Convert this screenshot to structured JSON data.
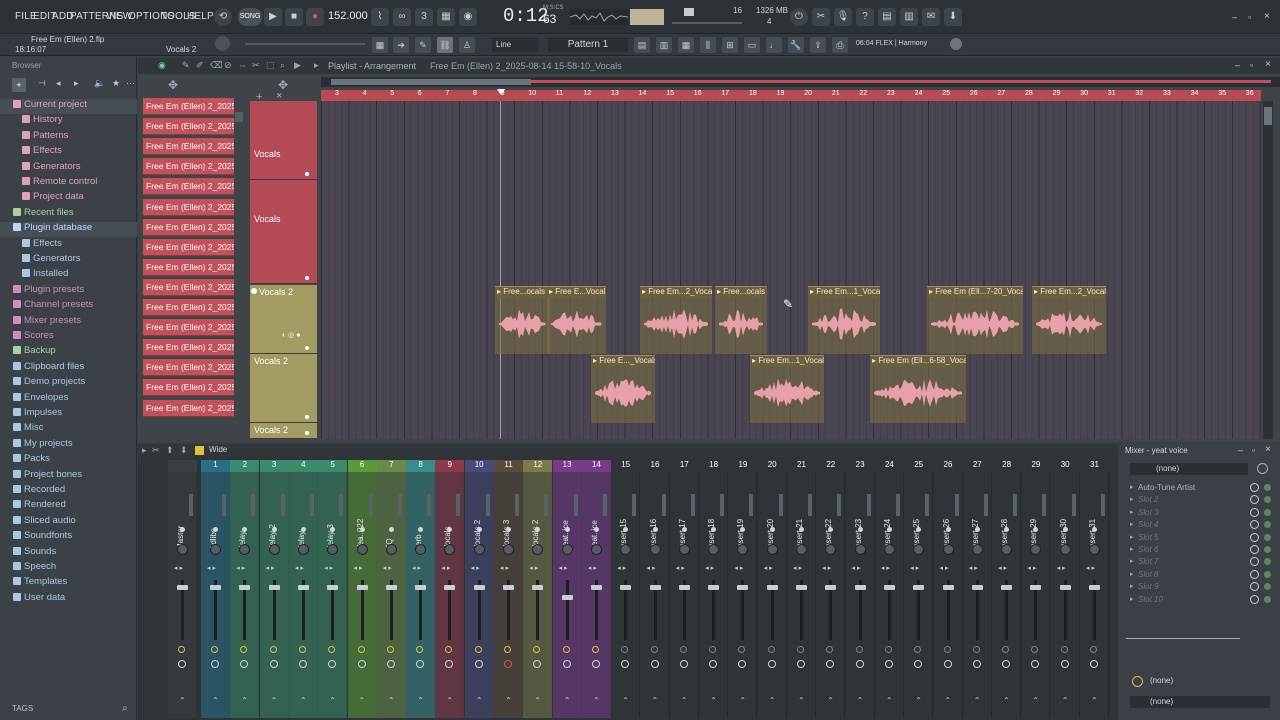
{
  "menu": [
    "FILE",
    "EDIT",
    "ADD",
    "PATTERNS",
    "VIEW",
    "OPTIONS",
    "TOOLS",
    "HELP"
  ],
  "transport": {
    "mode": "SONG",
    "tempo": "152.000",
    "time": "0:12",
    "time_sub": "63",
    "time_label": "M:S:CS",
    "pattern": "Pattern 1",
    "memory": "1326 MB",
    "cpu": "16",
    "voices": "4"
  },
  "project": {
    "file": "Free Em (Ellen) 2.flp",
    "time": "18:16:07",
    "channel": "Vocals 2",
    "snap": "Line",
    "hint": "06:04 FLEX | Harmony"
  },
  "browser": {
    "title": "Browser",
    "items": [
      {
        "label": "Current project",
        "color": "#e0a0b8",
        "indent": 0,
        "hl": true
      },
      {
        "label": "History",
        "color": "#e0a0b8",
        "indent": 1
      },
      {
        "label": "Patterns",
        "color": "#e0a0b8",
        "indent": 1
      },
      {
        "label": "Effects",
        "color": "#e0a0b8",
        "indent": 1
      },
      {
        "label": "Generators",
        "color": "#e0a0b8",
        "indent": 1
      },
      {
        "label": "Remote control",
        "color": "#e0a0b8",
        "indent": 1
      },
      {
        "label": "Project data",
        "color": "#e0a0b8",
        "indent": 1
      },
      {
        "label": "Recent files",
        "color": "#a8d2a0",
        "indent": 0
      },
      {
        "label": "Plugin database",
        "color": "#b8d8ff",
        "indent": 0,
        "hl": true
      },
      {
        "label": "Effects",
        "color": "#a8c8e8",
        "indent": 1
      },
      {
        "label": "Generators",
        "color": "#a8c8e8",
        "indent": 1
      },
      {
        "label": "Installed",
        "color": "#a8c8e8",
        "indent": 1
      },
      {
        "label": "Plugin presets",
        "color": "#d08cc0",
        "indent": 0
      },
      {
        "label": "Channel presets",
        "color": "#d08cc0",
        "indent": 0
      },
      {
        "label": "Mixer presets",
        "color": "#d08cc0",
        "indent": 0
      },
      {
        "label": "Scores",
        "color": "#d08cc0",
        "indent": 0
      },
      {
        "label": "Backup",
        "color": "#a8d2a0",
        "indent": 0
      },
      {
        "label": "Clipboard files",
        "color": "#a8c8e8",
        "indent": 0
      },
      {
        "label": "Demo projects",
        "color": "#a8c8e8",
        "indent": 0
      },
      {
        "label": "Envelopes",
        "color": "#a8c8e8",
        "indent": 0
      },
      {
        "label": "Impulses",
        "color": "#a8c8e8",
        "indent": 0
      },
      {
        "label": "Misc",
        "color": "#a8c8e8",
        "indent": 0
      },
      {
        "label": "My projects",
        "color": "#a8c8e8",
        "indent": 0
      },
      {
        "label": "Packs",
        "color": "#a8c8e8",
        "indent": 0
      },
      {
        "label": "Project bones",
        "color": "#a8c8e8",
        "indent": 0
      },
      {
        "label": "Recorded",
        "color": "#a8c8e8",
        "indent": 0
      },
      {
        "label": "Rendered",
        "color": "#a8c8e8",
        "indent": 0
      },
      {
        "label": "Sliced audio",
        "color": "#a8c8e8",
        "indent": 0
      },
      {
        "label": "Soundfonts",
        "color": "#a8c8e8",
        "indent": 0
      },
      {
        "label": "Sounds",
        "color": "#a8c8e8",
        "indent": 0
      },
      {
        "label": "Speech",
        "color": "#a8c8e8",
        "indent": 0
      },
      {
        "label": "Templates",
        "color": "#a8c8e8",
        "indent": 0
      },
      {
        "label": "User data",
        "color": "#a8c8e8",
        "indent": 0
      }
    ],
    "tags": "TAGS"
  },
  "playlist": {
    "title": "Playlist - Arrangement",
    "path": "Free Em (Ellen) 2_2025-08-14 15-58-10_Vocals",
    "patterns": [
      "Free Em (Ellen) 2_2025-0...",
      "Free Em (Ellen) 2_2025-0...",
      "Free Em (Ellen) 2_2025-0...",
      "Free Em (Ellen) 2_2025-0...",
      "Free Em (Ellen) 2_2025-0...",
      "Free Em (Ellen) 2_2025-0...",
      "Free Em (Ellen) 2_2025-0...",
      "Free Em (Ellen) 2_2025-0...",
      "Free Em (Ellen) 2_2025-0...",
      "Free Em (Ellen) 2_2025-0...",
      "Free Em (Ellen) 2_2025-0...",
      "Free Em (Ellen) 2_2025-0...",
      "Free Em (Ellen) 2_2025-0...",
      "Free Em (Ellen) 2_2025-0...",
      "Free Em (Ellen) 2_2025-0...",
      "Free Em (Ellen) 2_2025-0..."
    ],
    "tracks": [
      "Vocals",
      "Vocals",
      "Vocals 2",
      "Vocals 2",
      "Vocals 2"
    ],
    "ruler": [
      "3",
      "4",
      "5",
      "6",
      "7",
      "8",
      "9",
      "10",
      "11",
      "12",
      "13",
      "14",
      "15",
      "16",
      "17",
      "18",
      "19",
      "20",
      "21",
      "22",
      "23",
      "24",
      "25",
      "26",
      "27",
      "28",
      "29",
      "30",
      "31",
      "32",
      "33",
      "34",
      "35",
      "36"
    ],
    "clips_row1": [
      "Free...ocals",
      "Free E...Vocals",
      "Free Em...2_Vocals",
      "Free...ocals",
      "Free Em...1_Vocals",
      "Free Em (Ell...7-20_Vocals",
      "Free Em...2_Vocals"
    ],
    "clips_row2": [
      "Free E..._Vocals",
      "Free Em...1_Vocals",
      "Free Em (Ell...6-58_Vocals"
    ]
  },
  "mixer": {
    "title": "Mixer - yeat voice",
    "view": "Wide",
    "strips": [
      {
        "num": "",
        "name": "Master",
        "color": "#3a3f44"
      },
      {
        "num": "1",
        "name": "Adlibs",
        "color": "#2a6f8a"
      },
      {
        "num": "2",
        "name": "delay",
        "color": "#3a8b6c"
      },
      {
        "num": "3",
        "name": "delay 2",
        "color": "#3a8b6c"
      },
      {
        "num": "4",
        "name": "delay",
        "color": "#3a8b6c"
      },
      {
        "num": "5",
        "name": "delay 3",
        "color": "#3a8b6c"
      },
      {
        "num": "6",
        "name": "Yea..022",
        "color": "#5b9a3a"
      },
      {
        "num": "7",
        "name": "EQ",
        "color": "#6a8a4a"
      },
      {
        "num": "8",
        "name": "verb",
        "color": "#3a8b8b"
      },
      {
        "num": "9",
        "name": "Vocals",
        "color": "#8b3a4a"
      },
      {
        "num": "10",
        "name": "Vocals 2",
        "color": "#4a4a7a"
      },
      {
        "num": "11",
        "name": "Vocals 3",
        "color": "#5a4a3a"
      },
      {
        "num": "12",
        "name": "Vocals 2",
        "color": "#7a7a4a"
      },
      {
        "num": "13",
        "name": "yeat..ice",
        "color": "#7a3a8a"
      },
      {
        "num": "14",
        "name": "yeat..ice",
        "color": "#7a3a8a"
      },
      {
        "num": "15",
        "name": "Insert 15",
        "color": ""
      },
      {
        "num": "16",
        "name": "Insert 16",
        "color": ""
      },
      {
        "num": "17",
        "name": "Insert 17",
        "color": ""
      },
      {
        "num": "18",
        "name": "Insert 18",
        "color": ""
      },
      {
        "num": "19",
        "name": "Insert 19",
        "color": ""
      },
      {
        "num": "20",
        "name": "Insert 20",
        "color": ""
      },
      {
        "num": "21",
        "name": "Insert 21",
        "color": ""
      },
      {
        "num": "22",
        "name": "Insert 22",
        "color": ""
      },
      {
        "num": "23",
        "name": "Insert 23",
        "color": ""
      },
      {
        "num": "24",
        "name": "Insert 24",
        "color": ""
      },
      {
        "num": "25",
        "name": "Insert 25",
        "color": ""
      },
      {
        "num": "26",
        "name": "Insert 26",
        "color": ""
      },
      {
        "num": "27",
        "name": "Insert 27",
        "color": ""
      },
      {
        "num": "28",
        "name": "Insert 28",
        "color": ""
      },
      {
        "num": "29",
        "name": "Insert 29",
        "color": ""
      },
      {
        "num": "30",
        "name": "Insert 30",
        "color": ""
      },
      {
        "num": "31",
        "name": "Insert 31",
        "color": ""
      }
    ],
    "input": "(none)",
    "slots": [
      "Auto-Tune Artist",
      "Slot 2",
      "Slot 3",
      "Slot 4",
      "Slot 5",
      "Slot 6",
      "Slot 7",
      "Slot 8",
      "Slot 9",
      "Slot 10"
    ],
    "out1": "(none)",
    "out2": "(none)"
  }
}
